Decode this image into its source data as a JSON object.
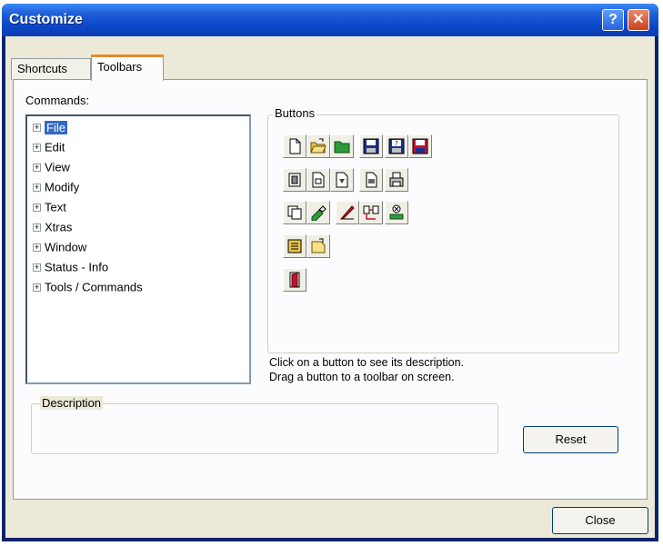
{
  "window": {
    "title": "Customize",
    "help_glyph": "?",
    "close_glyph": "✕"
  },
  "tabs": [
    {
      "label": "Shortcuts",
      "active": false
    },
    {
      "label": "Toolbars",
      "active": true
    }
  ],
  "commands": {
    "label": "Commands:",
    "expander_glyph": "+",
    "items": [
      {
        "label": "File",
        "selected": true
      },
      {
        "label": "Edit"
      },
      {
        "label": "View"
      },
      {
        "label": "Modify"
      },
      {
        "label": "Text"
      },
      {
        "label": "Xtras"
      },
      {
        "label": "Window"
      },
      {
        "label": "Status - Info"
      },
      {
        "label": "Tools / Commands"
      }
    ]
  },
  "buttons_panel": {
    "title": "Buttons",
    "icons": [
      "new-document-icon",
      "open-folder-icon",
      "folder-icon",
      "save-icon",
      "save-as-icon",
      "save-all-icon",
      "import-icon",
      "export-icon",
      "publish-icon",
      "page-setup-icon",
      "print-icon",
      "preferences-icon",
      "edit-cast-icon",
      "erase-icon",
      "link-icon",
      "revert-icon",
      "properties-icon",
      "create-projector-icon",
      "exit-icon"
    ]
  },
  "hint": {
    "line1": "Click on a button to see its description.",
    "line2": "Drag a button to a toolbar on screen."
  },
  "description": {
    "title": "Description",
    "value": ""
  },
  "actions": {
    "reset_label": "Reset",
    "close_label": "Close"
  },
  "colors": {
    "title_bar": "#0b46c8",
    "face": "#ece9d8",
    "selection": "#316ac5",
    "tab_highlight": "#e68b2c"
  }
}
